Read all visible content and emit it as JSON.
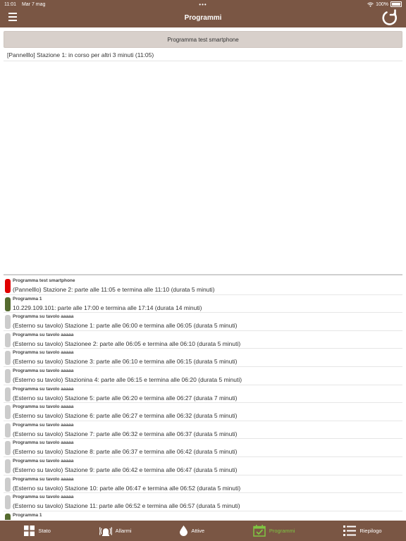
{
  "statusbar": {
    "time": "11:01",
    "date": "Mar 7 mag",
    "dots": "•••",
    "battery": "100%"
  },
  "navbar": {
    "title": "Programmi"
  },
  "test_button": {
    "label": "Programma test smartphone"
  },
  "running": {
    "text": "[Pannelllo] Stazione 1: in corso per altri 3 minuti (11:05)"
  },
  "colors": {
    "brown": "#7a5644",
    "red": "#e00000",
    "green": "#556b2f",
    "grey": "#cccccc",
    "active_tab": "#7fc542"
  },
  "schedule": [
    {
      "program": "Programma test smartphone",
      "desc": "(Pannelllo) Stazione 2: parte alle 11:05 e termina alle 11:10 (durata 5 minuti)",
      "status": "red"
    },
    {
      "program": "Programma 1",
      "desc": "10.229.109.101: parte alle 17:00 e termina alle 17:14 (durata 14 minuti)",
      "status": "green"
    },
    {
      "program": "Programma su tavolo aaaaa",
      "desc": "(Esterno su tavolo) Stazione 1: parte alle 06:00 e termina alle 06:05 (durata 5 minuti)",
      "status": "grey"
    },
    {
      "program": "Programma su tavolo aaaaa",
      "desc": "(Esterno su tavolo) Stazionee 2: parte alle 06:05 e termina alle 06:10 (durata 5 minuti)",
      "status": "grey"
    },
    {
      "program": "Programma su tavolo aaaaa",
      "desc": "(Esterno su tavolo) Stazione 3: parte alle 06:10 e termina alle 06:15 (durata 5 minuti)",
      "status": "grey"
    },
    {
      "program": "Programma su tavolo aaaaa",
      "desc": "(Esterno su tavolo) Stazionina 4: parte alle 06:15 e termina alle 06:20 (durata 5 minuti)",
      "status": "grey"
    },
    {
      "program": "Programma su tavolo aaaaa",
      "desc": "(Esterno su tavolo) Stazione 5: parte alle 06:20 e termina alle 06:27 (durata 7 minuti)",
      "status": "grey"
    },
    {
      "program": "Programma su tavolo aaaaa",
      "desc": "(Esterno su tavolo) Stazione 6: parte alle 06:27 e termina alle 06:32 (durata 5 minuti)",
      "status": "grey"
    },
    {
      "program": "Programma su tavolo aaaaa",
      "desc": "(Esterno su tavolo) Stazione 7: parte alle 06:32 e termina alle 06:37 (durata 5 minuti)",
      "status": "grey"
    },
    {
      "program": "Programma su tavolo aaaaa",
      "desc": "(Esterno su tavolo) Stazione 8: parte alle 06:37 e termina alle 06:42 (durata 5 minuti)",
      "status": "grey"
    },
    {
      "program": "Programma su tavolo aaaaa",
      "desc": "(Esterno su tavolo) Stazione 9: parte alle 06:42 e termina alle 06:47 (durata 5 minuti)",
      "status": "grey"
    },
    {
      "program": "Programma su tavolo aaaaa",
      "desc": "(Esterno su tavolo) Stazione 10: parte alle 06:47 e termina alle 06:52 (durata 5 minuti)",
      "status": "grey"
    },
    {
      "program": "Programma su tavolo aaaaa",
      "desc": "(Esterno su tavolo) Stazione 11: parte alle 06:52 e termina alle 06:57 (durata 5 minuti)",
      "status": "grey"
    },
    {
      "program": "Programma 1",
      "desc": "",
      "status": "green"
    }
  ],
  "tabs": [
    {
      "label": "Stato",
      "icon": "grid-icon"
    },
    {
      "label": "Allarmi",
      "icon": "alarm-icon"
    },
    {
      "label": "Attive",
      "icon": "drop-icon"
    },
    {
      "label": "Programmi",
      "icon": "calendar-check-icon",
      "active": true
    },
    {
      "label": "Riepilogo",
      "icon": "list-icon"
    }
  ]
}
